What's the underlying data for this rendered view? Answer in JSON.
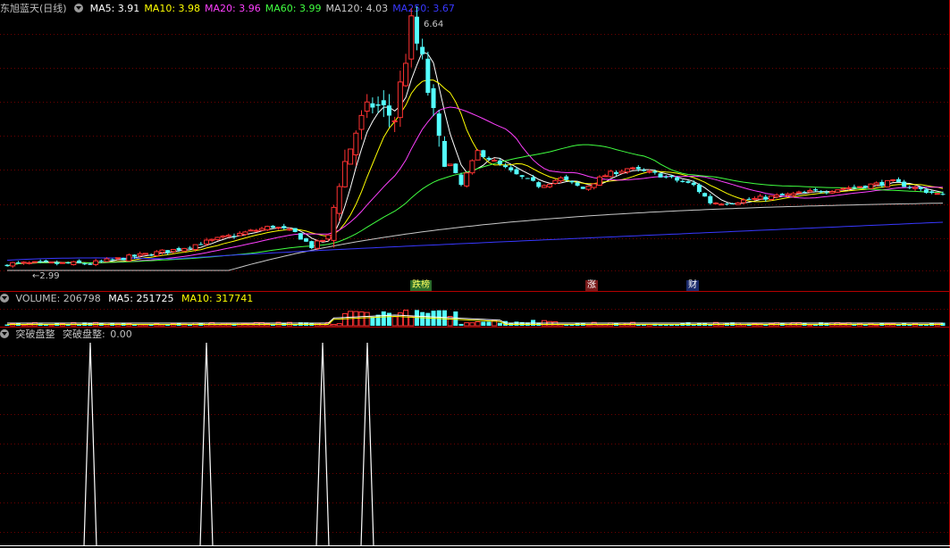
{
  "main_panel": {
    "title": "东旭蓝天(日线)",
    "indicators": [
      {
        "label": "MA5:",
        "value": "3.91",
        "color": "#ffffff"
      },
      {
        "label": "MA10:",
        "value": "3.98",
        "color": "#ffff00"
      },
      {
        "label": "MA20:",
        "value": "3.96",
        "color": "#ff40ff"
      },
      {
        "label": "MA60:",
        "value": "3.99",
        "color": "#40ff40"
      },
      {
        "label": "MA120:",
        "value": "4.03",
        "color": "#c8c8c8"
      },
      {
        "label": "MA250:",
        "value": "3.67",
        "color": "#3838ff"
      }
    ],
    "high_label": "6.64",
    "low_label": "2.99",
    "low_arrow": "←",
    "events": [
      {
        "text": "跌榜",
        "bg": "#2a6a2a",
        "color": "#ffff60"
      },
      {
        "text": "涨",
        "bg": "#7a1a1a",
        "color": "#ffffff"
      },
      {
        "text": "财",
        "bg": "#1a2a6a",
        "color": "#ffffff"
      }
    ]
  },
  "volume_panel": {
    "title": "VOLUME:",
    "title_value": "206798",
    "ma5_label": "MA5:",
    "ma5_value": "251725",
    "ma10_label": "MA10:",
    "ma10_value": "317741"
  },
  "breakout_panel": {
    "title": "突破盘整",
    "value_label": "突破盘整:",
    "value": "0.00"
  },
  "chart_data": {
    "type": "candlestick",
    "price_high": 6.64,
    "price_low": 2.99,
    "moving_averages": [
      "MA5",
      "MA10",
      "MA20",
      "MA60",
      "MA120",
      "MA250"
    ],
    "breakout_signal_count": 4,
    "colors": {
      "up": "#ff3232",
      "down": "#54ffff",
      "grid": "#6e0000",
      "signal": "#ffffff"
    }
  }
}
